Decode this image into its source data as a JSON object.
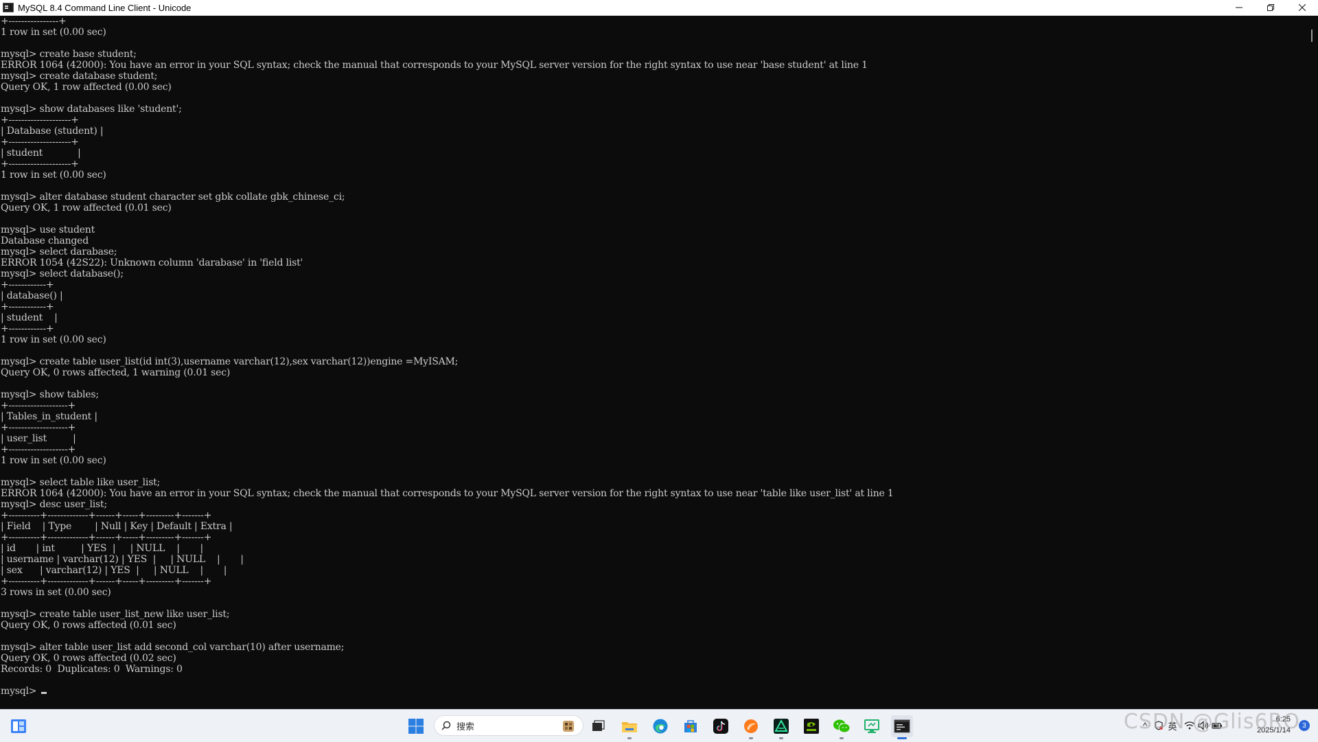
{
  "window": {
    "title": "MySQL 8.4 Command Line Client - Unicode",
    "minimize_glyph": "—",
    "restore_glyph": "❐",
    "close_glyph": "✕"
  },
  "console": {
    "lines": [
      "+----------------+",
      "1 row in set (0.00 sec)",
      "",
      "mysql> create base student;",
      "ERROR 1064 (42000): You have an error in your SQL syntax; check the manual that corresponds to your MySQL server version for the right syntax to use near 'base student' at line 1",
      "mysql> create database student;",
      "Query OK, 1 row affected (0.00 sec)",
      "",
      "mysql> show databases like 'student';",
      "+--------------------+",
      "| Database (student) |",
      "+--------------------+",
      "| student            |",
      "+--------------------+",
      "1 row in set (0.00 sec)",
      "",
      "mysql> alter database student character set gbk collate gbk_chinese_ci;",
      "Query OK, 1 row affected (0.01 sec)",
      "",
      "mysql> use student",
      "Database changed",
      "mysql> select darabase;",
      "ERROR 1054 (42S22): Unknown column 'darabase' in 'field list'",
      "mysql> select database();",
      "+------------+",
      "| database() |",
      "+------------+",
      "| student    |",
      "+------------+",
      "1 row in set (0.00 sec)",
      "",
      "mysql> create table user_list(id int(3),username varchar(12),sex varchar(12))engine =MyISAM;",
      "Query OK, 0 rows affected, 1 warning (0.01 sec)",
      "",
      "mysql> show tables;",
      "+-------------------+",
      "| Tables_in_student |",
      "+-------------------+",
      "| user_list         |",
      "+-------------------+",
      "1 row in set (0.00 sec)",
      "",
      "mysql> select table like user_list;",
      "ERROR 1064 (42000): You have an error in your SQL syntax; check the manual that corresponds to your MySQL server version for the right syntax to use near 'table like user_list' at line 1",
      "mysql> desc user_list;",
      "+----------+-------------+------+-----+---------+-------+",
      "| Field    | Type        | Null | Key | Default | Extra |",
      "+----------+-------------+------+-----+---------+-------+",
      "| id       | int         | YES  |     | NULL    |       |",
      "| username | varchar(12) | YES  |     | NULL    |       |",
      "| sex      | varchar(12) | YES  |     | NULL    |       |",
      "+----------+-------------+------+-----+---------+-------+",
      "3 rows in set (0.00 sec)",
      "",
      "mysql> create table user_list_new like user_list;",
      "Query OK, 0 rows affected (0.01 sec)",
      "",
      "mysql> alter table user_list add second_col varchar(10) after username;",
      "Query OK, 0 rows affected (0.02 sec)",
      "Records: 0  Duplicates: 0  Warnings: 0",
      ""
    ],
    "prompt": "mysql> "
  },
  "taskbar": {
    "search_label": "搜索",
    "apps": [
      {
        "name": "file-explorer-taskbar-icon"
      },
      {
        "name": "folder-taskbar-icon"
      },
      {
        "name": "edge-browser-taskbar-icon"
      },
      {
        "name": "microsoft-store-taskbar-icon"
      },
      {
        "name": "tiktok-taskbar-icon"
      },
      {
        "name": "orange-app-taskbar-icon"
      },
      {
        "name": "green-triangle-app-taskbar-icon"
      },
      {
        "name": "nvidia-taskbar-icon"
      },
      {
        "name": "wechat-taskbar-icon"
      },
      {
        "name": "remote-desktop-taskbar-icon"
      },
      {
        "name": "mysql-client-taskbar-icon"
      }
    ]
  },
  "tray": {
    "chevron": "^",
    "ime_label": "英",
    "time": "6:25",
    "date": "2025/1/14",
    "notification_count": "3"
  },
  "watermark": "CSDN @Glis6RO",
  "colors": {
    "console_bg": "#0c0c0c",
    "console_fg": "#cccccc",
    "taskbar_bg": "#eef1f6",
    "accent": "#2d6bd6"
  }
}
